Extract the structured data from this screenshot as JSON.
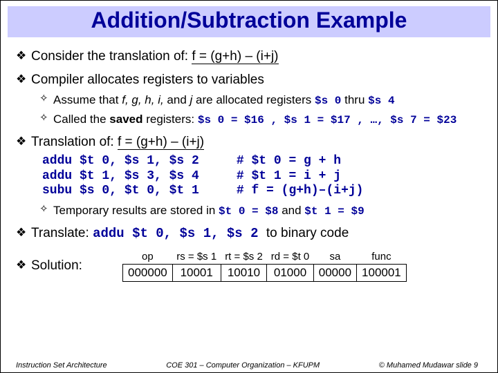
{
  "title": "Addition/Subtraction Example",
  "symbols": {
    "level1": "❖",
    "level2": "✧"
  },
  "b1": {
    "pre": "Consider the translation of: ",
    "expr": "f = (g+h) – (i+j)"
  },
  "b2": "Compiler allocates registers to variables",
  "b2a": {
    "pre": "Assume that ",
    "vars": "f, g, h, i,",
    "mid": " and ",
    "lastvar": "j",
    "post": " are allocated registers ",
    "r1": "$s 0",
    "thru": " thru ",
    "r2": "$s 4"
  },
  "b2b": {
    "pre": "Called the ",
    "bold": "saved",
    "post": " registers: ",
    "map": "$s 0 = $16 , $s 1 = $17 , …, $s 7 = $23"
  },
  "b3": {
    "pre": "Translation of: ",
    "expr": "f = (g+h) – (i+j)"
  },
  "code": "addu $t 0, $s 1, $s 2     # $t 0 = g + h\naddu $t 1, $s 3, $s 4     # $t 1 = i + j\nsubu $s 0, $t 0, $t 1     # f = (g+h)–(i+j)",
  "b3a": {
    "pre": "Temporary results are stored in ",
    "r1": "$t 0 = $8",
    "and": " and ",
    "r2": "$t 1 = $9"
  },
  "b4": {
    "pre": "Translate: ",
    "instr": "addu $t 0, $s 1, $s 2 ",
    "post": "to binary code"
  },
  "b5": "Solution:",
  "table": {
    "headers": [
      "op",
      "rs = $s 1",
      "rt = $s 2",
      "rd = $t 0",
      "sa",
      "func"
    ],
    "row": [
      "000000",
      "10001",
      "10010",
      "01000",
      "00000",
      "100001"
    ]
  },
  "footer": {
    "left": "Instruction Set Architecture",
    "center": "COE 301 – Computer Organization – KFUPM",
    "right": "© Muhamed Mudawar   slide 9"
  }
}
